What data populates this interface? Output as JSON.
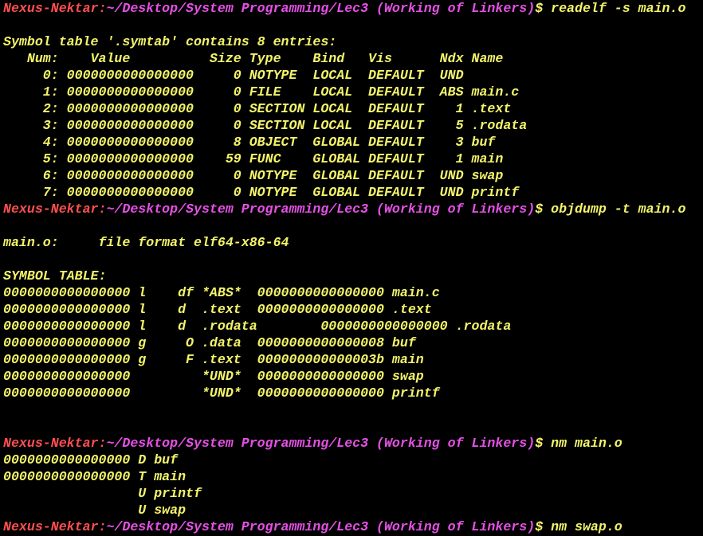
{
  "prompt": {
    "user_host": "Nexus-Nektar:",
    "path": "~/Desktop/System Programming/Lec3 (Working of Linkers)",
    "symbol": "$"
  },
  "colors": {
    "background": "#000000",
    "text": "#f3f36b",
    "user_host": "#ff4f4f",
    "path": "#e550e5"
  },
  "blocks": [
    {
      "command": "readelf -s main.o",
      "output": [
        "",
        "Symbol table '.symtab' contains 8 entries:",
        "   Num:    Value          Size Type    Bind   Vis      Ndx Name",
        "     0: 0000000000000000     0 NOTYPE  LOCAL  DEFAULT  UND",
        "     1: 0000000000000000     0 FILE    LOCAL  DEFAULT  ABS main.c",
        "     2: 0000000000000000     0 SECTION LOCAL  DEFAULT    1 .text",
        "     3: 0000000000000000     0 SECTION LOCAL  DEFAULT    5 .rodata",
        "     4: 0000000000000000     8 OBJECT  GLOBAL DEFAULT    3 buf",
        "     5: 0000000000000000    59 FUNC    GLOBAL DEFAULT    1 main",
        "     6: 0000000000000000     0 NOTYPE  GLOBAL DEFAULT  UND swap",
        "     7: 0000000000000000     0 NOTYPE  GLOBAL DEFAULT  UND printf"
      ]
    },
    {
      "command": "objdump -t main.o",
      "output": [
        "",
        "main.o:     file format elf64-x86-64",
        "",
        "SYMBOL TABLE:",
        "0000000000000000 l    df *ABS*  0000000000000000 main.c",
        "0000000000000000 l    d  .text  0000000000000000 .text",
        "0000000000000000 l    d  .rodata        0000000000000000 .rodata",
        "0000000000000000 g     O .data  0000000000000008 buf",
        "0000000000000000 g     F .text  000000000000003b main",
        "0000000000000000         *UND*  0000000000000000 swap",
        "0000000000000000         *UND*  0000000000000000 printf",
        "",
        ""
      ]
    },
    {
      "command": "nm main.o",
      "output": [
        "0000000000000000 D buf",
        "0000000000000000 T main",
        "                 U printf",
        "                 U swap"
      ]
    },
    {
      "command": "nm swap.o",
      "output": []
    }
  ]
}
